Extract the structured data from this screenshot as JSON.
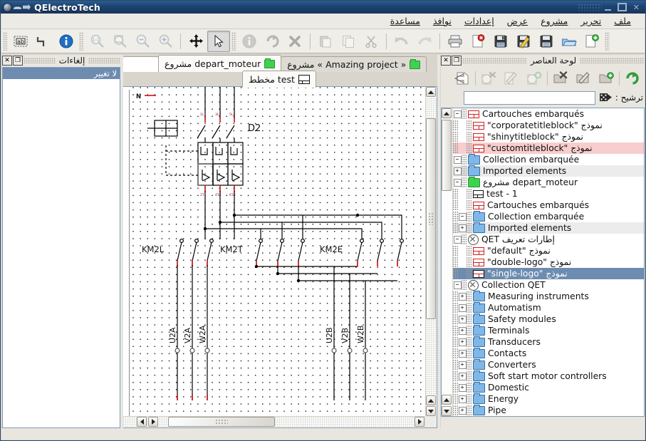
{
  "window": {
    "title": "QElectroTech",
    "minimize_label": "_",
    "maximize_label": "□",
    "close_label": "✕"
  },
  "menubar": {
    "items": [
      {
        "label": "ملف",
        "name": "menu-file"
      },
      {
        "label": "تحرير",
        "name": "menu-edit"
      },
      {
        "label": "مشروع",
        "name": "menu-project"
      },
      {
        "label": "عرض",
        "name": "menu-view"
      },
      {
        "label": "إعدادات",
        "name": "menu-settings"
      },
      {
        "label": "نوافذ",
        "name": "menu-windows"
      },
      {
        "label": "مساعدة",
        "name": "menu-help"
      }
    ]
  },
  "toolbar": {
    "groups": [
      {
        "buttons": [
          {
            "name": "add-text-button",
            "icon": "text-ab-icon",
            "enabled": true,
            "checked": false
          },
          {
            "name": "add-line-button",
            "icon": "polyline-icon",
            "enabled": true,
            "checked": false
          },
          {
            "name": "element-info-button",
            "icon": "info-blue-icon",
            "enabled": true,
            "checked": false
          }
        ]
      },
      {
        "buttons": [
          {
            "name": "zoom-reset-button",
            "icon": "zoom-1to1-icon",
            "enabled": false,
            "checked": false
          },
          {
            "name": "zoom-fit-button",
            "icon": "zoom-fit-icon",
            "enabled": false,
            "checked": false
          },
          {
            "name": "zoom-out-button",
            "icon": "zoom-out-icon",
            "enabled": false,
            "checked": false
          },
          {
            "name": "zoom-in-button",
            "icon": "zoom-in-icon",
            "enabled": false,
            "checked": false
          }
        ]
      },
      {
        "buttons": [
          {
            "name": "pan-tool-button",
            "icon": "move-arrows-icon",
            "enabled": true,
            "checked": false
          },
          {
            "name": "select-tool-button",
            "icon": "cursor-arrow-icon",
            "enabled": true,
            "checked": true
          }
        ]
      },
      {
        "buttons": [
          {
            "name": "properties-button",
            "icon": "info-grey-icon",
            "enabled": false,
            "checked": false
          },
          {
            "name": "rotate-button",
            "icon": "rotate-icon",
            "enabled": false,
            "checked": false
          },
          {
            "name": "delete-button",
            "icon": "delete-x-icon",
            "enabled": false,
            "checked": false
          }
        ]
      },
      {
        "buttons": [
          {
            "name": "paste-button",
            "icon": "paste-icon",
            "enabled": false,
            "checked": false
          },
          {
            "name": "copy-button",
            "icon": "copy-icon",
            "enabled": false,
            "checked": false
          },
          {
            "name": "cut-button",
            "icon": "scissors-icon",
            "enabled": false,
            "checked": false
          }
        ]
      },
      {
        "buttons": [
          {
            "name": "redo-button",
            "icon": "redo-icon",
            "enabled": false,
            "checked": false
          },
          {
            "name": "undo-button",
            "icon": "undo-icon",
            "enabled": false,
            "checked": false
          }
        ]
      },
      {
        "buttons": [
          {
            "name": "print-button",
            "icon": "printer-icon",
            "enabled": true,
            "checked": false
          },
          {
            "name": "close-project-button",
            "icon": "file-close-icon",
            "enabled": true,
            "checked": false
          },
          {
            "name": "save-button",
            "icon": "save-icon",
            "enabled": true,
            "checked": false
          },
          {
            "name": "save-as-button",
            "icon": "save-as-icon",
            "enabled": true,
            "checked": false
          },
          {
            "name": "save-all-button",
            "icon": "save-all-icon",
            "enabled": true,
            "checked": false
          },
          {
            "name": "open-button",
            "icon": "open-folder-icon",
            "enabled": true,
            "checked": false
          },
          {
            "name": "new-button",
            "icon": "file-new-icon",
            "enabled": true,
            "checked": false
          }
        ]
      }
    ]
  },
  "left_dock": {
    "title": "إلغاءات",
    "float_label": "❐",
    "close_label": "✕",
    "items": [
      {
        "label": "لا تغيير",
        "selected": true
      }
    ]
  },
  "tabs": {
    "row1": [
      {
        "label": "depart_moteur مشروع",
        "icon": "green-folder-icon",
        "active": true,
        "name": "tab-project-depart-moteur"
      },
      {
        "label": "« Amazing project » مشروع",
        "icon": "green-folder-icon",
        "active": false,
        "name": "tab-project-amazing"
      }
    ],
    "row2": [
      {
        "label": "test مخطط",
        "icon": "diagram-icon",
        "active": true,
        "name": "tab-diagram-test"
      }
    ]
  },
  "diagram": {
    "terminal_label": "N",
    "breaker_label": "D2",
    "contactor_labels": [
      "KM2L",
      "KM2T",
      "KM2E"
    ],
    "phase_markers": [
      "1L1",
      "3L2",
      "5L3"
    ],
    "output_markers": [
      "2T1",
      "4T2",
      "6T3"
    ],
    "conductor_labels": [
      "U2A",
      "V2A",
      "W2A",
      "U2B",
      "V2B",
      "W2B"
    ]
  },
  "right_dock": {
    "title": "لوحة العناصر",
    "float_label": "❐",
    "close_label": "✕",
    "toolbar_buttons": [
      {
        "name": "refresh-collections-button",
        "icon": "refresh-green-icon",
        "enabled": true
      },
      {
        "name": "new-category-button",
        "icon": "folder-new-icon",
        "enabled": true
      },
      {
        "name": "edit-category-button",
        "icon": "folder-edit-icon",
        "enabled": true
      },
      {
        "name": "delete-category-button",
        "icon": "folder-delete-icon",
        "enabled": true
      },
      {
        "name": "new-element-button",
        "icon": "element-new-icon",
        "enabled": false
      },
      {
        "name": "edit-element-button",
        "icon": "element-edit-icon",
        "enabled": false
      },
      {
        "name": "delete-element-button",
        "icon": "element-delete-icon",
        "enabled": false
      },
      {
        "name": "open-element-button",
        "icon": "element-open-icon",
        "enabled": false
      }
    ],
    "filter": {
      "label": "ترشيح :",
      "value": "",
      "placeholder": "",
      "clear_icon": "filter-clear-icon"
    },
    "tree": [
      {
        "label": "Cartouches embarqués",
        "icon": "titleblock-icon",
        "indent": 0,
        "expander": "minus",
        "state": "normal"
      },
      {
        "label": "نموذج \"corporatetitleblock\"",
        "icon": "titleblock-icon",
        "indent": 1,
        "expander": "none",
        "state": "normal"
      },
      {
        "label": "نموذج \"shinytitleblock\"",
        "icon": "titleblock-icon",
        "indent": 1,
        "expander": "none",
        "state": "normal"
      },
      {
        "label": "نموذج \"customtitleblock\"",
        "icon": "titleblock-icon",
        "indent": 1,
        "expander": "none",
        "state": "warn"
      },
      {
        "label": "Collection embarquée",
        "icon": "folder-blue-icon",
        "indent": 0,
        "expander": "minus",
        "state": "normal"
      },
      {
        "label": "Imported elements",
        "icon": "folder-blue-icon",
        "indent": 0,
        "expander": "plus",
        "state": "alt"
      },
      {
        "label": "depart_moteur مشروع",
        "icon": "folder-green-icon",
        "indent": 0,
        "expander": "minus",
        "state": "normal"
      },
      {
        "label": "test - 1",
        "icon": "diagram-icon",
        "indent": 1,
        "expander": "none",
        "state": "normal"
      },
      {
        "label": "Cartouches embarqués",
        "icon": "titleblock-icon",
        "indent": 1,
        "expander": "none",
        "state": "normal"
      },
      {
        "label": "Collection embarquée",
        "icon": "folder-blue-icon",
        "indent": 1,
        "expander": "minus",
        "state": "normal"
      },
      {
        "label": "Imported elements",
        "icon": "folder-blue-icon",
        "indent": 1,
        "expander": "plus",
        "state": "alt"
      },
      {
        "label": "إطارات تعريف QET",
        "icon": "qet-icon",
        "indent": 0,
        "expander": "minus",
        "state": "normal"
      },
      {
        "label": "نموذج \"default\"",
        "icon": "titleblock-icon",
        "indent": 1,
        "expander": "none",
        "state": "normal"
      },
      {
        "label": "نموذج \"double-logo\"",
        "icon": "titleblock-icon",
        "indent": 1,
        "expander": "none",
        "state": "normal"
      },
      {
        "label": "نموذج \"single-logo\"",
        "icon": "titleblock-dark-icon",
        "indent": 1,
        "expander": "none",
        "state": "selected"
      },
      {
        "label": "Collection QET",
        "icon": "qet-icon",
        "indent": 0,
        "expander": "minus",
        "state": "normal"
      },
      {
        "label": "Measuring instruments",
        "icon": "folder-blue-icon",
        "indent": 1,
        "expander": "plus",
        "state": "normal"
      },
      {
        "label": "Automatism",
        "icon": "folder-blue-icon",
        "indent": 1,
        "expander": "plus",
        "state": "normal"
      },
      {
        "label": "Safety modules",
        "icon": "folder-blue-icon",
        "indent": 1,
        "expander": "plus",
        "state": "normal"
      },
      {
        "label": "Terminals",
        "icon": "folder-blue-icon",
        "indent": 1,
        "expander": "plus",
        "state": "normal"
      },
      {
        "label": "Transducers",
        "icon": "folder-blue-icon",
        "indent": 1,
        "expander": "plus",
        "state": "normal"
      },
      {
        "label": "Contacts",
        "icon": "folder-blue-icon",
        "indent": 1,
        "expander": "plus",
        "state": "normal"
      },
      {
        "label": "Converters",
        "icon": "folder-blue-icon",
        "indent": 1,
        "expander": "plus",
        "state": "normal"
      },
      {
        "label": "Soft start motor controllers",
        "icon": "folder-blue-icon",
        "indent": 1,
        "expander": "plus",
        "state": "normal"
      },
      {
        "label": "Domestic",
        "icon": "folder-blue-icon",
        "indent": 1,
        "expander": "plus",
        "state": "normal"
      },
      {
        "label": "Energy",
        "icon": "folder-blue-icon",
        "indent": 1,
        "expander": "plus",
        "state": "normal"
      },
      {
        "label": "Pipe",
        "icon": "folder-blue-icon",
        "indent": 1,
        "expander": "plus",
        "state": "normal"
      }
    ]
  }
}
